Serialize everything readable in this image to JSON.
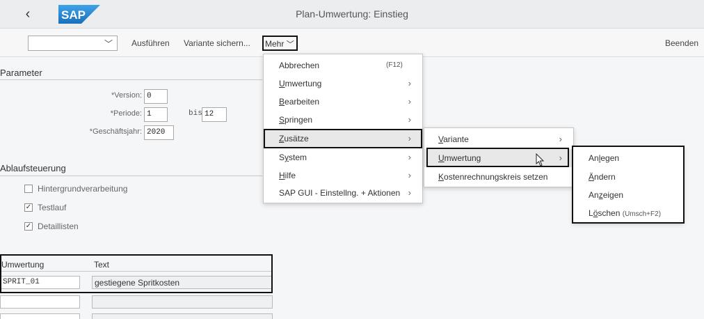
{
  "titlebar": {
    "title": "Plan-Umwertung: Einstieg",
    "back_icon": "‹",
    "logo": "SAP"
  },
  "toolbar": {
    "variant_value": "",
    "execute_label": "Ausführen",
    "save_variant_label": "Variante sichern...",
    "more_label": "Mehr",
    "exit_label": "Beenden"
  },
  "parameter": {
    "heading": "Parameter",
    "version_label": "Version:",
    "version_value": "0",
    "period_label": "Periode:",
    "period_from": "1",
    "period_to_label": "bis",
    "period_to": "12",
    "fiscal_year_label": "Geschäftsjahr:",
    "fiscal_year_value": "2020"
  },
  "ablauf": {
    "heading": "Ablaufsteuerung",
    "background_label": "Hintergrundverarbeitung",
    "background_checked": false,
    "testrun_label": "Testlauf",
    "testrun_checked": true,
    "details_label": "Detaillisten",
    "details_checked": true
  },
  "table": {
    "col1": "Umwertung",
    "col2": "Text",
    "rows": [
      {
        "umwertung": "SPRIT_01",
        "text": "gestiegene Spritkosten"
      },
      {
        "umwertung": "",
        "text": ""
      },
      {
        "umwertung": "",
        "text": ""
      }
    ]
  },
  "menu1": {
    "items": [
      {
        "label": "Abbrechen",
        "shortcut": "(F12)"
      },
      {
        "label": "Umwertung"
      },
      {
        "label": "Bearbeiten"
      },
      {
        "label": "Springen"
      },
      {
        "label": "Zusätze"
      },
      {
        "label": "System"
      },
      {
        "label": "Hilfe"
      },
      {
        "label": "SAP GUI - Einstellng. + Aktionen"
      }
    ]
  },
  "menu2": {
    "items": [
      {
        "label": "Variante"
      },
      {
        "label": "Umwertung"
      },
      {
        "label": "Kostenrechnungskreis setzen"
      }
    ]
  },
  "menu3": {
    "items": [
      {
        "label": "Anlegen"
      },
      {
        "label": "Ändern"
      },
      {
        "label": "Anzeigen"
      },
      {
        "label": "Löschen",
        "shortcut": "(Umsch+F2)"
      }
    ]
  },
  "colors": {
    "accent": "#111111",
    "background": "#f5f6f7",
    "sap_blue": "#1b6fbf"
  }
}
